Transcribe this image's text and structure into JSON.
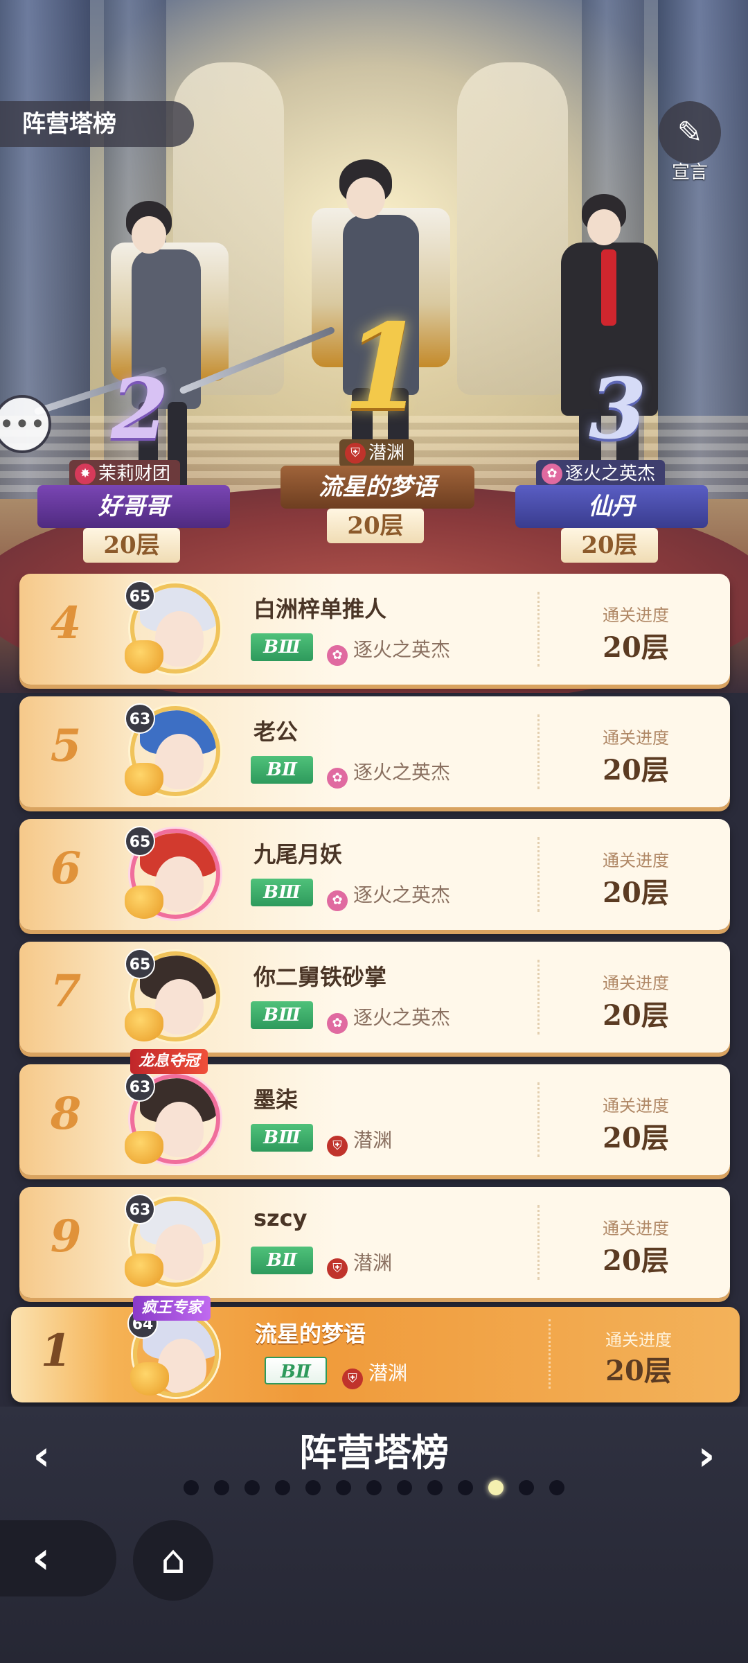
{
  "header": {
    "title": "阵营塔榜",
    "declare_label": "宣言",
    "declare_icon": "edit-note-icon",
    "chat_icon": "chat-bubble-icon"
  },
  "podium": [
    {
      "rank": "1",
      "faction": "潜渊",
      "faction_color": "#c0332b",
      "name": "流星的梦语",
      "floor": "20层"
    },
    {
      "rank": "2",
      "faction": "茉莉财团",
      "faction_color": "#d63a5a",
      "name": "好哥哥",
      "floor": "20层"
    },
    {
      "rank": "3",
      "faction": "逐火之英杰",
      "faction_color": "#e06aa0",
      "name": "仙丹",
      "floor": "20层"
    }
  ],
  "progress_label": "通关进度",
  "rows": [
    {
      "rank": "4",
      "level": "65",
      "name": "白洲梓单推人",
      "tier": "BⅢ",
      "faction": "逐火之英杰",
      "faction_color": "#e06aa0",
      "floor": "20层",
      "frame": "gold"
    },
    {
      "rank": "5",
      "level": "63",
      "name": "老公",
      "tier": "BⅡ",
      "faction": "逐火之英杰",
      "faction_color": "#e06aa0",
      "floor": "20层",
      "frame": "gold"
    },
    {
      "rank": "6",
      "level": "65",
      "name": "九尾月妖",
      "tier": "BⅢ",
      "faction": "逐火之英杰",
      "faction_color": "#e06aa0",
      "floor": "20层",
      "frame": "pink"
    },
    {
      "rank": "7",
      "level": "65",
      "name": "你二舅铁砂掌",
      "tier": "BⅢ",
      "faction": "逐火之英杰",
      "faction_color": "#e06aa0",
      "floor": "20层",
      "frame": "gold"
    },
    {
      "rank": "8",
      "level": "63",
      "name": "墨柒",
      "tier": "BⅢ",
      "faction": "潜渊",
      "faction_color": "#c0332b",
      "floor": "20层",
      "frame": "pink",
      "banner": "龙息夺冠"
    },
    {
      "rank": "9",
      "level": "63",
      "name": "szcy",
      "tier": "BⅡ",
      "faction": "潜渊",
      "faction_color": "#c0332b",
      "floor": "20层",
      "frame": "gold"
    }
  ],
  "self_row": {
    "rank": "1",
    "level": "64",
    "name": "流星的梦语",
    "tier": "BⅡ",
    "faction": "潜渊",
    "faction_color": "#c0332b",
    "floor": "20层",
    "banner": "疯王专家"
  },
  "footer": {
    "page_title": "阵营塔榜",
    "prev_icon": "chevron-left-icon",
    "next_icon": "chevron-right-icon",
    "page_count": 13,
    "active_page": 11,
    "back_icon": "back-arrow-icon",
    "home_icon": "home-icon"
  }
}
